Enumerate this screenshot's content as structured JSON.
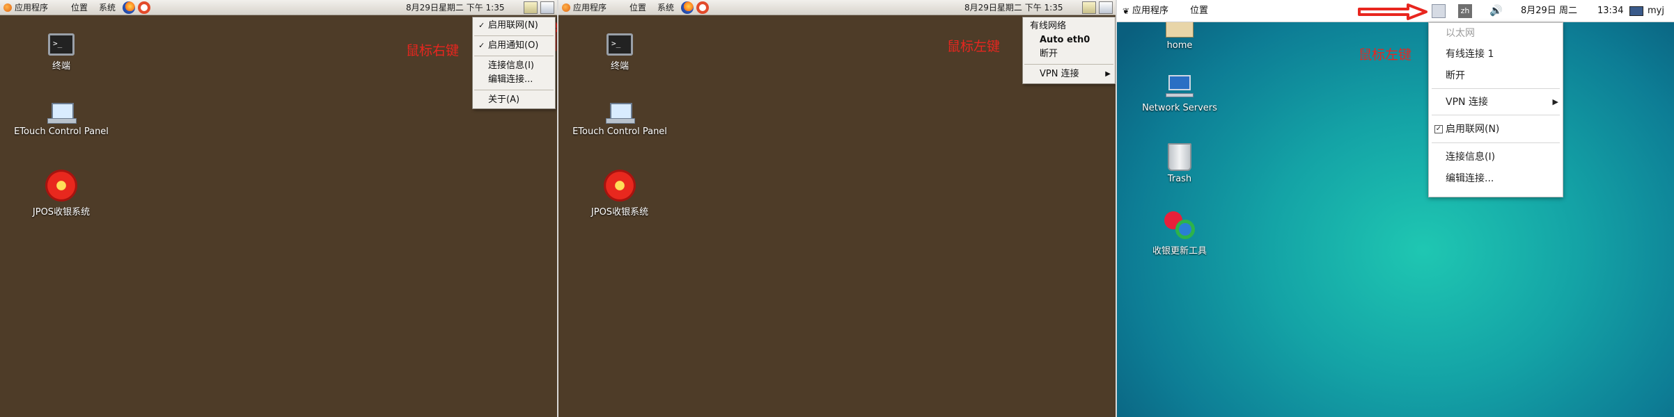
{
  "panel1": {
    "topbar": {
      "apps": "应用程序",
      "places": "位置",
      "system": "系统",
      "clock": "8月29日星期二 下午  1:35"
    },
    "desktop_icons": [
      {
        "label": "终端",
        "icon": "terminal-icon"
      },
      {
        "label": "ETouch Control Panel",
        "icon": "laptop-icon"
      },
      {
        "label": "JPOS收银系统",
        "icon": "jpos-icon"
      }
    ],
    "annotation": "鼠标右键",
    "context_menu": {
      "enable_networking": "启用联网(N)",
      "enable_notifications": "启用通知(O)",
      "connection_info": "连接信息(I)",
      "edit_connections": "编辑连接...",
      "about": "关于(A)"
    }
  },
  "panel2": {
    "topbar": {
      "apps": "应用程序",
      "places": "位置",
      "system": "系统",
      "clock": "8月29日星期二 下午  1:35"
    },
    "desktop_icons": [
      {
        "label": "终端",
        "icon": "terminal-icon"
      },
      {
        "label": "ETouch Control Panel",
        "icon": "laptop-icon"
      },
      {
        "label": "JPOS收银系统",
        "icon": "jpos-icon"
      }
    ],
    "annotation": "鼠标左键",
    "network_menu": {
      "header": "有线网络",
      "connection": "Auto eth0",
      "disconnect": "断开",
      "vpn": "VPN 连接"
    }
  },
  "panel3": {
    "topbar": {
      "apps": "应用程序",
      "places": "位置",
      "input_method": "zh",
      "date": "8月29日 周二",
      "time": "13:34",
      "user": "myj"
    },
    "desktop_icons": [
      {
        "label": "home",
        "icon": "home-folder-icon"
      },
      {
        "label": "Network Servers",
        "icon": "network-servers-icon"
      },
      {
        "label": "Trash",
        "icon": "trash-icon"
      },
      {
        "label": "收银更新工具",
        "icon": "update-tool-icon"
      }
    ],
    "annotation": "鼠标左键",
    "network_menu": {
      "ethernet": "以太网",
      "wired_connection": "有线连接 1",
      "disconnect": "断开",
      "vpn": "VPN 连接",
      "enable_networking": "启用联网(N)",
      "connection_info": "连接信息(I)",
      "edit_connections": "编辑连接..."
    }
  },
  "colors": {
    "annotation_red": "#e8261f",
    "desktop_brown": "#4e3c28",
    "desktop_teal": "#14a3a6"
  }
}
